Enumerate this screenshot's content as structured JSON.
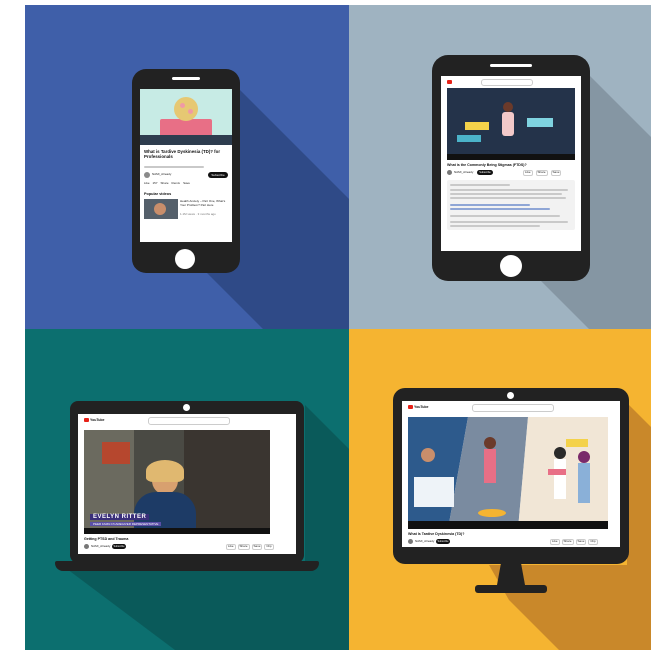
{
  "phone": {
    "video_title": "What is Tardive Dyskinesia (TD)? for Professionals",
    "channel_name": "NAMI_Already",
    "subscribe_label": "Subscribe",
    "actions": [
      "Like",
      "157",
      "Share",
      "Remix",
      "Save"
    ],
    "section_heading": "Popular videos",
    "related_title": "Health Anxiety – Part One, What's Your Problem? Part Here",
    "related_meta": "1.1M views · 3 months ago"
  },
  "tablet": {
    "video_title": "What is the Commonly Being Stigmas (FTDS)?",
    "channel_name": "NAMI_Already",
    "subscribe_label": "Subscribe",
    "actions": [
      "Like",
      "Share",
      "Save"
    ]
  },
  "laptop": {
    "brand": "YouTube",
    "caption_name": "EVELYN RITTER",
    "caption_sub": "PEER FAMILY/CAREGIVER REPRESENTATIVE",
    "video_title": "Getting PTSD and Trauma",
    "channel_name": "NAMI_Already",
    "subscribe_label": "Subscribe",
    "actions": [
      "Like",
      "Share",
      "Save",
      "Clip"
    ]
  },
  "monitor": {
    "brand": "YouTube",
    "video_title": "What Is Tardive Dyskinesia (TD)?",
    "channel_name": "NAMI_Already",
    "subscribe_label": "Subscribe",
    "actions": [
      "Like",
      "Share",
      "Save",
      "Clip"
    ]
  },
  "colors": {
    "panel_blue": "#3f5fa9",
    "panel_gray": "#9fb3c1",
    "panel_teal": "#0c6f6f",
    "panel_yellow": "#f5b431",
    "device_frame": "#222222",
    "youtube_red": "#e62117"
  }
}
